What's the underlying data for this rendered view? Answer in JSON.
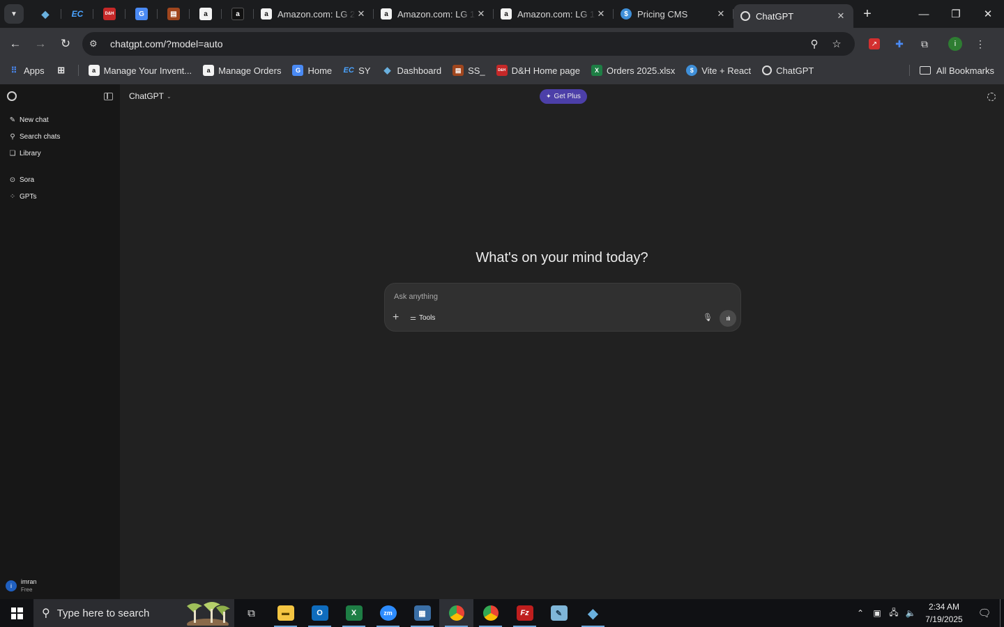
{
  "browser": {
    "tab_search_icon": "chevron-down-icon",
    "pinned_tabs": [
      {
        "name": "pinned-tab-diamond",
        "glyph": "◆",
        "color": "#6ab0de"
      },
      {
        "name": "pinned-tab-ec",
        "glyph": "EC",
        "color": "#1a73e8"
      },
      {
        "name": "pinned-tab-dh",
        "glyph": "D&H",
        "color": "#c62828"
      },
      {
        "name": "pinned-tab-gdoc",
        "glyph": "G",
        "color": "#4a8af4"
      },
      {
        "name": "pinned-tab-box",
        "glyph": "▤",
        "color": "#d84315"
      },
      {
        "name": "pinned-tab-amazon-1",
        "glyph": "a",
        "color": "#f3f3f3"
      },
      {
        "name": "pinned-tab-amazon-2",
        "glyph": "a",
        "color": "#f3f3f3"
      }
    ],
    "tabs": [
      {
        "title": "Amazon.com: LG 2",
        "favicon": "amazon-icon"
      },
      {
        "title": "Amazon.com: LG 1",
        "favicon": "amazon-icon"
      },
      {
        "title": "Amazon.com: LG 1",
        "favicon": "amazon-icon"
      },
      {
        "title": "Pricing CMS",
        "favicon": "dollar-icon"
      },
      {
        "title": "ChatGPT",
        "favicon": "openai-icon",
        "active": true
      }
    ],
    "url": "chatgpt.com/?model=auto",
    "bookmarks": [
      {
        "label": "Apps",
        "icon": "apps-grid-icon"
      },
      {
        "label": "",
        "icon": "grid-icon"
      },
      {
        "label": "Manage Your Invent...",
        "icon": "amazon-icon"
      },
      {
        "label": "Manage Orders",
        "icon": "amazon-icon"
      },
      {
        "label": "Home",
        "icon": "g-icon"
      },
      {
        "label": "SY",
        "icon": "ec-icon"
      },
      {
        "label": "Dashboard",
        "icon": "diamond-icon"
      },
      {
        "label": "SS_",
        "icon": "box-icon"
      },
      {
        "label": "D&H Home page",
        "icon": "dh-icon"
      },
      {
        "label": "Orders 2025.xlsx",
        "icon": "excel-icon"
      },
      {
        "label": "Vite + React",
        "icon": "dollar-icon"
      },
      {
        "label": "ChatGPT",
        "icon": "openai-icon"
      }
    ],
    "all_bookmarks": "All Bookmarks",
    "profile_initial": "i"
  },
  "sidebar": {
    "items": [
      {
        "label": "New chat",
        "icon": "edit-icon"
      },
      {
        "label": "Search chats",
        "icon": "search-icon"
      },
      {
        "label": "Library",
        "icon": "library-icon"
      },
      {
        "label": "Sora",
        "icon": "play-icon"
      },
      {
        "label": "GPTs",
        "icon": "grid-icon"
      }
    ],
    "user": {
      "initial": "i",
      "name": "imran",
      "plan": "Free"
    }
  },
  "main": {
    "model_label": "ChatGPT",
    "get_plus": "Get Plus",
    "headline": "What's on your mind today?",
    "composer": {
      "placeholder": "Ask anything",
      "tools_label": "Tools"
    }
  },
  "taskbar": {
    "search_placeholder": "Type here to search",
    "apps": [
      {
        "name": "task-view-icon"
      },
      {
        "name": "file-explorer-icon"
      },
      {
        "name": "outlook-icon"
      },
      {
        "name": "excel-icon"
      },
      {
        "name": "zoom-icon"
      },
      {
        "name": "calculator-icon"
      },
      {
        "name": "chrome-icon"
      },
      {
        "name": "chrome-profile-icon"
      },
      {
        "name": "filezilla-icon"
      },
      {
        "name": "notepad-icon"
      },
      {
        "name": "app-diamond-icon"
      }
    ],
    "time": "2:34 AM",
    "date": "7/19/2025"
  }
}
